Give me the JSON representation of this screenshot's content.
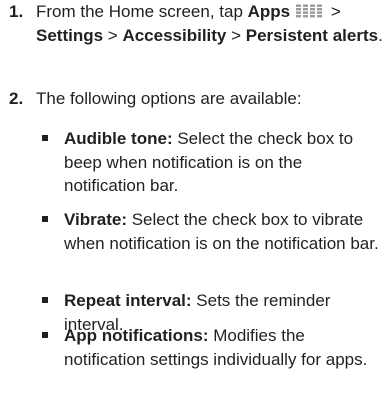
{
  "steps": [
    {
      "number": "1.",
      "t1": "From the Home screen, tap ",
      "apps": "Apps",
      "t2": " > ",
      "settings": "Settings",
      "t3": " > ",
      "accessibility": "Accessibility",
      "t4": " > ",
      "persistent_alerts": "Persistent alerts",
      "t5": "."
    },
    {
      "number": "2.",
      "text": "The following options are available:"
    }
  ],
  "options": [
    {
      "term": "Audible tone:",
      "desc": " Select the check box to beep when notification is on the notification bar."
    },
    {
      "term": "Vibrate:",
      "desc": " Select the check box to vibrate when notification is on the notification bar."
    },
    {
      "term": "Repeat interval:",
      "desc": " Sets the reminder interval."
    },
    {
      "term": "App notifications:",
      "desc": " Modifies the notification settings individually for apps."
    }
  ],
  "icons": {
    "apps": "apps-grid-icon"
  },
  "colors": {
    "text": "#231f20",
    "apps_icon_dots": "#9a9a9a"
  }
}
